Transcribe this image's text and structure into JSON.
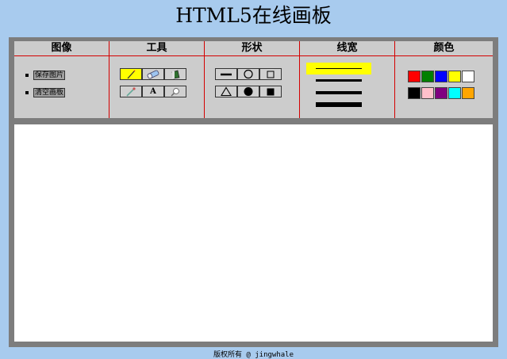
{
  "title": "HTML5在线画板",
  "sections": {
    "image": "图像",
    "tools": "工具",
    "shapes": "形状",
    "line_width": "线宽",
    "color": "颜色"
  },
  "image_actions": {
    "save": "保存图片",
    "clear": "清空画板"
  },
  "tools": {
    "items": [
      "pencil-icon",
      "eraser-icon",
      "bucket-icon",
      "eyedropper-icon",
      "text-icon",
      "magnifier-icon"
    ],
    "text_glyph": "A",
    "active": "pencil-icon"
  },
  "shapes": {
    "items": [
      "line-icon",
      "circle-outline-icon",
      "square-outline-icon",
      "triangle-outline-icon",
      "circle-filled-icon",
      "square-filled-icon"
    ]
  },
  "line_widths": {
    "count": 4,
    "selected_index": 0
  },
  "colors": [
    "#ff0000",
    "#008000",
    "#0000ff",
    "#ffff00",
    "#ffffff",
    "#000000",
    "#ffc0cb",
    "#800080",
    "#00ffff",
    "#ffa500"
  ],
  "highlight_color": "#ffff00",
  "footer": "版权所有 @ jingwhale"
}
